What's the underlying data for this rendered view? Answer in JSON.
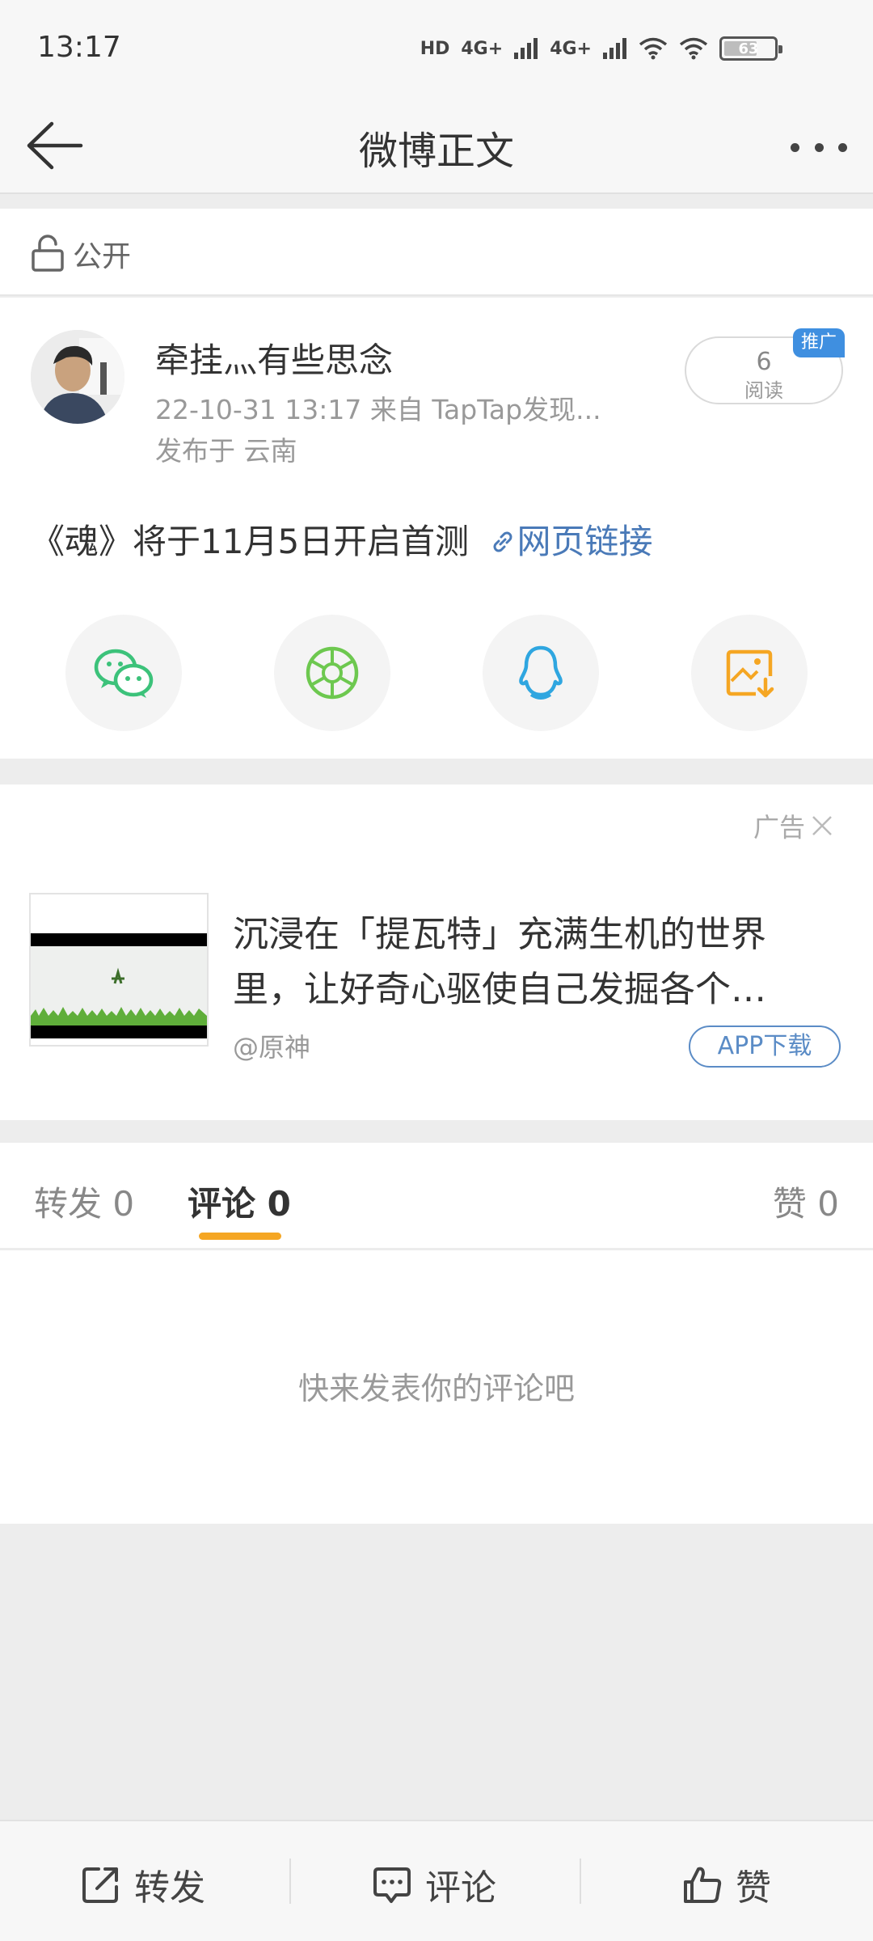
{
  "status_bar": {
    "time": "13:17",
    "hd_label": "HD",
    "network_1": "4G+",
    "network_2": "4G+",
    "battery_level": "63"
  },
  "nav": {
    "title": "微博正文"
  },
  "visibility": {
    "label": "公开"
  },
  "post": {
    "username": "牵挂灬有些思念",
    "meta": "22-10-31 13:17   来自 TapTap发现...",
    "location": "发布于 云南",
    "read_count": "6",
    "read_label": "阅读",
    "promo_tag": "推广",
    "text": "《魂》将于11月5日开启首测",
    "link_text": "网页链接"
  },
  "share_targets": [
    {
      "icon": "wechat-icon",
      "color": "#3cc27a"
    },
    {
      "icon": "moments-icon",
      "color": "#6dc84f"
    },
    {
      "icon": "qq-icon",
      "color": "#2fa6e0"
    },
    {
      "icon": "save-image-icon",
      "color": "#f5a623"
    }
  ],
  "ad": {
    "label": "广告",
    "title": "沉浸在「提瓦特」充满生机的世界里，让好奇心驱使自己发掘各个…",
    "source": "@原神",
    "button": "APP下载"
  },
  "tabs": [
    {
      "label": "转发 0"
    },
    {
      "label": "评论 0",
      "active": true
    },
    {
      "label": "赞 0"
    }
  ],
  "comments": {
    "empty_text": "快来发表你的评论吧"
  },
  "bottom_bar": {
    "repost": "转发",
    "comment": "评论",
    "like": "赞"
  },
  "colors": {
    "accent": "#f5a623",
    "link": "#4a7ab8",
    "promo": "#3f8fe0"
  }
}
